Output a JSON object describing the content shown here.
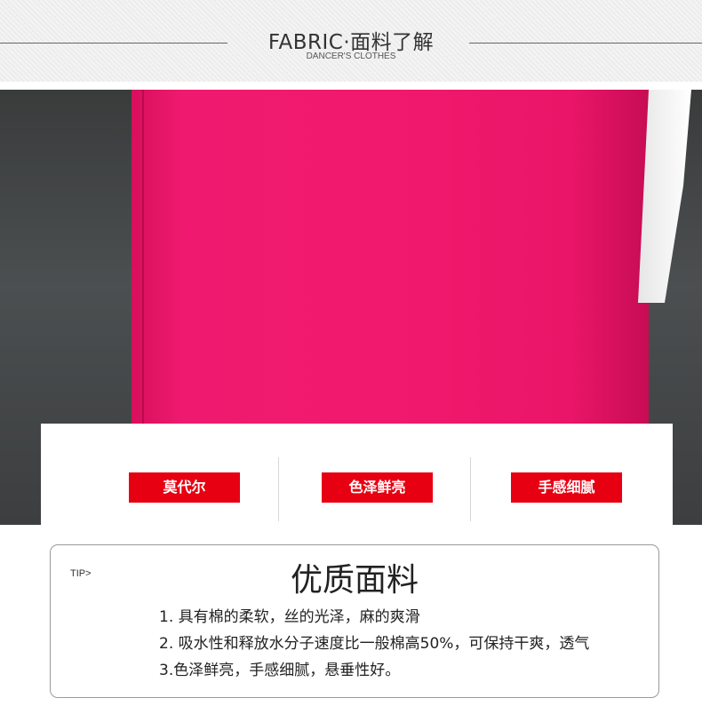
{
  "header": {
    "title": "FABRIC·面料了解",
    "subtitle": "DANCER'S CLOTHES"
  },
  "photo": {
    "fabric_color": "#f0196d",
    "background_color": "#404344"
  },
  "features": [
    {
      "label": "莫代尔"
    },
    {
      "label": "色泽鲜亮"
    },
    {
      "label": "手感细腻"
    }
  ],
  "feature_color": "#e60012",
  "tip": {
    "label": "TIP>",
    "title": "优质面料",
    "items": [
      "1. 具有棉的柔软，丝的光泽，麻的爽滑",
      "2. 吸水性和释放水分子速度比一般棉高50%，可保持干爽，透气",
      "3.色泽鲜亮，手感细腻，悬垂性好。"
    ]
  }
}
